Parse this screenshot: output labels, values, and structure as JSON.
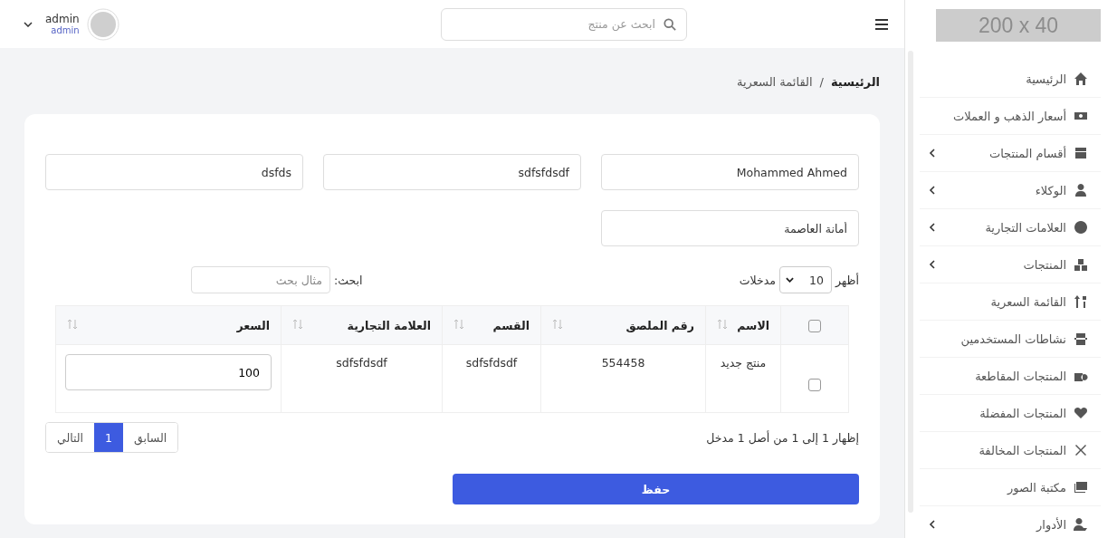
{
  "sidebar": {
    "logo": "200 x 40",
    "items": [
      {
        "label": "الرئيسية",
        "expandable": false
      },
      {
        "label": "أسعار الذهب و العملات",
        "expandable": false
      },
      {
        "label": "أقسام المنتجات",
        "expandable": true
      },
      {
        "label": "الوكلاء",
        "expandable": true
      },
      {
        "label": "العلامات التجارية",
        "expandable": true
      },
      {
        "label": "المنتجات",
        "expandable": true
      },
      {
        "label": "القائمة السعرية",
        "expandable": false
      },
      {
        "label": "نشاطات المستخدمين",
        "expandable": false
      },
      {
        "label": "المنتجات المقاطعة",
        "expandable": false
      },
      {
        "label": "المنتجات المفضلة",
        "expandable": false
      },
      {
        "label": "المنتجات المخالفة",
        "expandable": false
      },
      {
        "label": "مكتبة الصور",
        "expandable": false
      },
      {
        "label": "الأدوار",
        "expandable": true
      }
    ]
  },
  "header": {
    "search": {
      "placeholder": "ابحث عن منتج"
    },
    "user": {
      "name": "admin",
      "role": "admin"
    }
  },
  "breadcrumb": {
    "items": [
      "الرئيسية",
      "القائمة السعرية"
    ],
    "separator": "/"
  },
  "form": {
    "fields": [
      {
        "value": "Mohammed Ahmed"
      },
      {
        "value": "sdfsfdsdf"
      },
      {
        "value": "dsfds"
      },
      {
        "value": "أمانة العاصمة"
      }
    ]
  },
  "table_controls": {
    "show_label": "أظهر",
    "page_size": "10",
    "entries_label": "مدخلات",
    "search_label": "ابحث:",
    "search_placeholder": "مثال بحث"
  },
  "table": {
    "select_all_checked": false,
    "columns": [
      "الاسم",
      "رقم الملصق",
      "القسم",
      "العلامة التجارية",
      "السعر"
    ],
    "rows": [
      {
        "checked": false,
        "cells": [
          "منتج جديد",
          "554458",
          "sdfsfdsdf",
          "sdfsfdsdf"
        ],
        "price": "100"
      }
    ]
  },
  "info": "إظهار 1 إلى 1 من أصل 1 مدخل",
  "pagination": {
    "previous": "السابق",
    "pages": [
      {
        "label": "1",
        "selected": true
      }
    ],
    "next": "التالي"
  },
  "save_button": "حفظ"
}
